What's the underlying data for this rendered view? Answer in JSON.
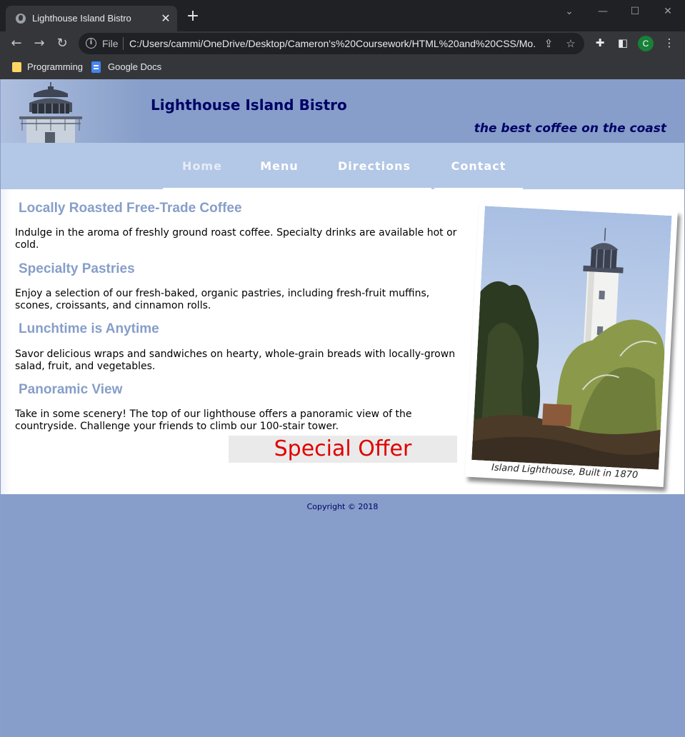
{
  "browser": {
    "tab_title": "Lighthouse Island Bistro",
    "tab_close": "✕",
    "new_tab": "+",
    "window_controls": {
      "collapse": "⌄",
      "minimize": "—",
      "maximize": "☐",
      "close": "✕"
    },
    "omnibox": {
      "info_icon": "i",
      "scheme_label": "File",
      "url": "C:/Users/cammi/OneDrive/Desktop/Cameron's%20Coursework/HTML%20and%20CSS/Mo..."
    },
    "avatar_letter": "C",
    "bookmarks": [
      {
        "label": "Programming",
        "icon": "folder-icon"
      },
      {
        "label": "Google Docs",
        "icon": "google-docs-icon"
      }
    ]
  },
  "site": {
    "title": "Lighthouse Island Bistro",
    "tagline": "the best coffee on the coast",
    "nav": [
      {
        "label": "Home",
        "active": true
      },
      {
        "label": "Menu",
        "active": false
      },
      {
        "label": "Directions",
        "active": false
      },
      {
        "label": "Contact",
        "active": false
      }
    ],
    "sections": [
      {
        "heading": "Locally Roasted Free-Trade Coffee",
        "text": "Indulge in the aroma of freshly ground roast coffee. Specialty drinks are available hot or cold."
      },
      {
        "heading": "Specialty Pastries",
        "text": "Enjoy a selection of our fresh-baked, organic pastries, including fresh-fruit muffins, scones, croissants, and cinnamon rolls."
      },
      {
        "heading": "Lunchtime is Anytime",
        "text": "Savor delicious wraps and sandwiches on hearty, whole-grain breads with locally-grown salad, fruit, and vegetables."
      },
      {
        "heading": "Panoramic View",
        "text": "Take in some scenery! The top of our lighthouse offers a panoramic view of the countryside. Challenge your friends to climb our 100-stair tower."
      }
    ],
    "special_offer": "Special Offer",
    "figure_caption": "Island Lighthouse, Built in 1870",
    "copyright": "Copyright © 2018"
  },
  "colors": {
    "brand_navy": "#000066",
    "header_blue": "#869ec9",
    "nav_blue": "#b3c7e6",
    "heading_blue": "#869ec9",
    "offer_red": "#e00000"
  }
}
